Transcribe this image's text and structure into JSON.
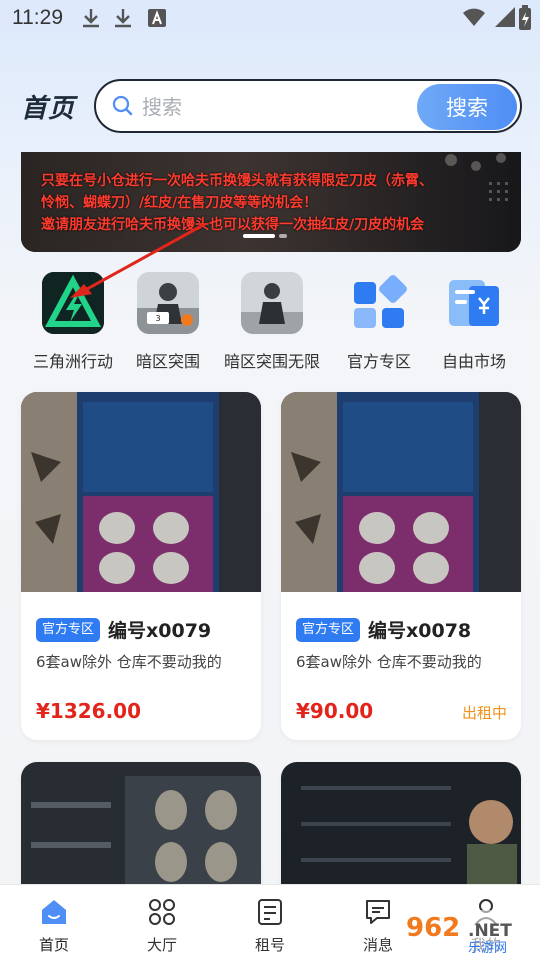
{
  "status_bar": {
    "time": "11:29"
  },
  "header": {
    "title": "首页"
  },
  "search": {
    "placeholder": "搜索",
    "button_label": "搜索"
  },
  "banner": {
    "line1": "只要在号小仓进行一次哈夫币换馒头就有获得限定刀皮（赤霄、",
    "line2": "怜悯、蝴蝶刀）/红皮/在售刀皮等等的机会！",
    "line3": "邀请朋友进行哈夫币换馒头也可以获得一次抽红皮/刀皮的机会"
  },
  "categories": [
    {
      "label": "三角洲行动",
      "icon": "delta-force-icon"
    },
    {
      "label": "暗区突围",
      "icon": "arena-breakout-icon"
    },
    {
      "label": "暗区突围无限",
      "icon": "arena-breakout-infinite-icon"
    },
    {
      "label": "官方专区",
      "icon": "official-zone-icon"
    },
    {
      "label": "自由市场",
      "icon": "free-market-icon"
    }
  ],
  "products": [
    {
      "tag": "官方专区",
      "code": "编号x0079",
      "desc": "6套aw除外 仓库不要动我的",
      "price": "¥1326.00",
      "status": ""
    },
    {
      "tag": "官方专区",
      "code": "编号x0078",
      "desc": "6套aw除外 仓库不要动我的",
      "price": "¥90.00",
      "status": "出租中"
    }
  ],
  "bottom_nav": [
    {
      "label": "首页",
      "icon": "home-icon",
      "active": true
    },
    {
      "label": "大厅",
      "icon": "hall-icon",
      "active": false
    },
    {
      "label": "租号",
      "icon": "rent-icon",
      "active": false
    },
    {
      "label": "消息",
      "icon": "message-icon",
      "active": false
    },
    {
      "label": "我的",
      "icon": "profile-icon",
      "active": false
    }
  ],
  "watermark": {
    "brand": "962",
    "suffix": ".NET",
    "sub": "乐游网"
  },
  "colors": {
    "accent": "#2f7bf2",
    "price": "#e2241a",
    "status": "#f0911a"
  }
}
